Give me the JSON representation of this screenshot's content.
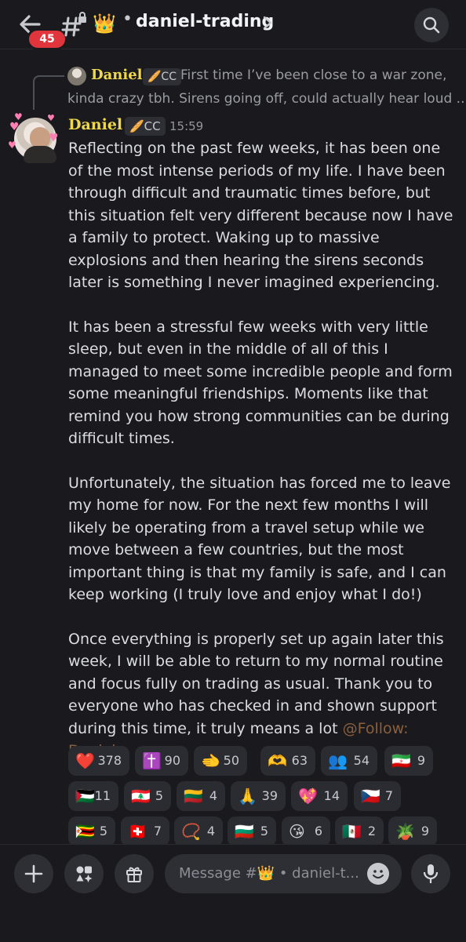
{
  "header": {
    "unread_badge": "45",
    "channel_emoji": "👑",
    "channel_separator": "•",
    "channel_name": "daniel-trading"
  },
  "reply": {
    "author": "Daniel",
    "tag": "🥖CC",
    "text_line1": "First time I’ve been close to a war zone,",
    "text_line2": "kinda crazy tbh. Sirens going off, could actually hear loud ..."
  },
  "message": {
    "author": "Daniel",
    "tag": "🥖CC",
    "time": "15:59",
    "paragraphs": [
      "Reflecting on the past few weeks, it has been one of the most intense periods of my life. I have been through difficult and traumatic times before, but this situation felt very different because now I have a family to protect. Waking up to massive explosions and then hearing the sirens seconds later is something I never imagined experiencing.",
      "It has been a stressful few weeks with very little sleep, but even in the middle of all of this I managed to meet some incredible people and form some meaningful friendships. Moments like that remind you how strong communities can be during difficult times.",
      "Unfortunately, the situation has forced me to leave my home for now. For the next few months I will likely be operating from a travel setup while we move between a few countries, but the most important thing is that my family is safe, and I can keep working (I truly love and enjoy what I do!)",
      "Once everything is properly set up again later this week, I will be able to return to my normal routine and focus fully on trading as usual. Thank you to everyone who has checked in and shown support during this time, it truly means a lot"
    ],
    "mention": "@Follow: Daniel"
  },
  "reactions": [
    {
      "emoji": "❤️",
      "count": "378"
    },
    {
      "emoji": "✝️",
      "count": "90"
    },
    {
      "emoji": "🫲",
      "count": "50"
    },
    {
      "emoji": "🫶",
      "count": "63"
    },
    {
      "emoji": "👥",
      "count": "54"
    },
    {
      "emoji": "🇮🇷",
      "count": "9"
    },
    {
      "emoji": "🇵🇸",
      "count": "11"
    },
    {
      "emoji": "🇱🇧",
      "count": "5"
    },
    {
      "emoji": "🇱🇹",
      "count": "4"
    },
    {
      "emoji": "🙏",
      "count": "39"
    },
    {
      "emoji": "💖",
      "count": "14"
    },
    {
      "emoji": "🇨🇿",
      "count": "7"
    },
    {
      "emoji": "🇿🇼",
      "count": "5"
    },
    {
      "emoji": "🇨🇭",
      "count": "7"
    },
    {
      "emoji": "📿",
      "count": "4"
    },
    {
      "emoji": "🇧🇬",
      "count": "5"
    },
    {
      "emoji": "😘",
      "count": "6"
    },
    {
      "emoji": "🇲🇽",
      "count": "2"
    },
    {
      "emoji": "🪴",
      "count": "9"
    }
  ],
  "composer": {
    "placeholder": "Message #👑 • daniel-t..."
  },
  "colors": {
    "background": "#1a1a1e",
    "username": "#f0d84b",
    "badge": "#e0353d",
    "mention": "#8a5f3c",
    "chip": "#2b2c31"
  },
  "icons": [
    "back-arrow-icon",
    "hashtag-lock-icon",
    "chevron-right-icon",
    "search-icon",
    "plus-icon",
    "apps-icon",
    "gift-icon",
    "emoji-icon",
    "mic-icon"
  ]
}
